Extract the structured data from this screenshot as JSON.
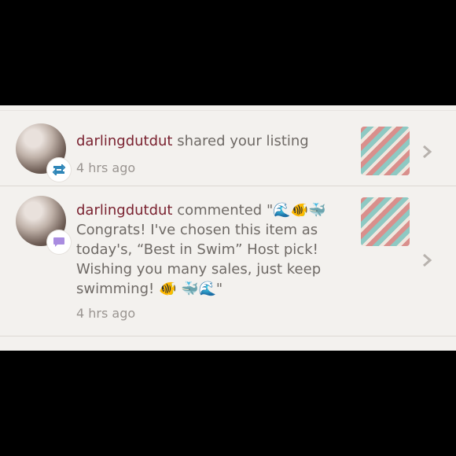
{
  "notifications": [
    {
      "username": "darlingdutdut",
      "action": " shared your listing",
      "time": "4 hrs ago",
      "badge_icon": "repost-icon"
    },
    {
      "username": "darlingdutdut",
      "action": " commented \"🌊🐠🐳 Congrats! I've chosen this item as today's, “Best in Swim” Host pick! Wishing you many sales, just keep swimming! 🐠 🐳🌊\"",
      "time": "4 hrs ago",
      "badge_icon": "comment-icon"
    }
  ],
  "colors": {
    "username": "#7a2230",
    "text": "#6f6a66",
    "time": "#9a9591",
    "repost_badge": "#2f86b8",
    "comment_badge": "#a98ce0",
    "chevron": "#b7b2ad",
    "background": "#f3f1ee"
  }
}
